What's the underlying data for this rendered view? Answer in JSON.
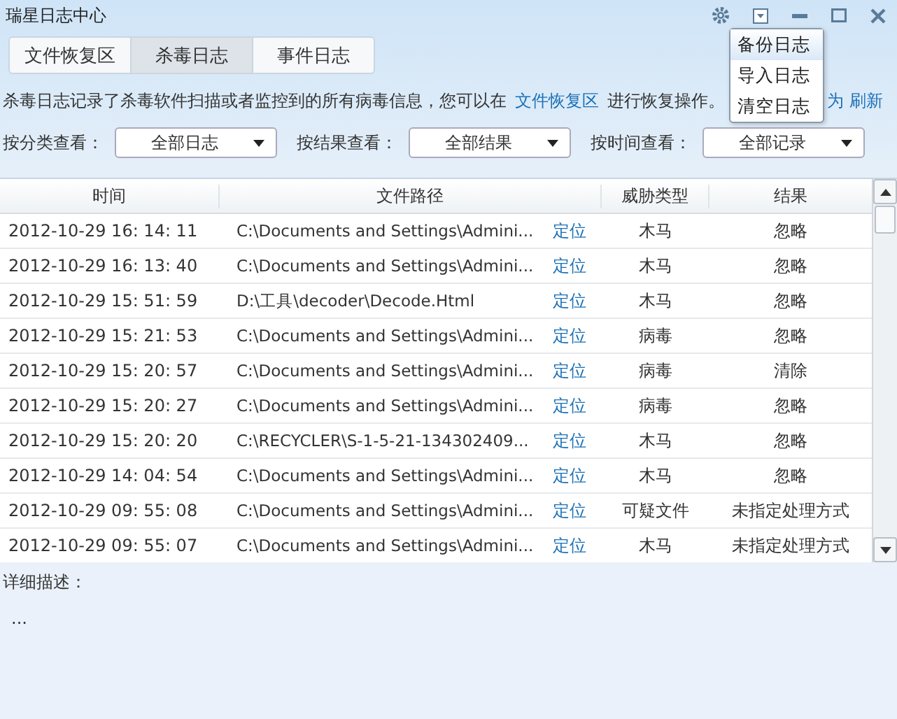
{
  "window": {
    "title": "瑞星日志中心"
  },
  "tabs": [
    {
      "label": "文件恢复区",
      "selected": false
    },
    {
      "label": "杀毒日志",
      "selected": true
    },
    {
      "label": "事件日志",
      "selected": false
    }
  ],
  "menu": {
    "items": [
      {
        "label": "备份日志",
        "selected": true
      },
      {
        "label": "导入日志",
        "selected": false
      },
      {
        "label": "清空日志",
        "selected": false
      }
    ]
  },
  "description": {
    "text": "杀毒日志记录了杀毒软件扫描或者监控到的所有病毒信息，您可以在",
    "link": "文件恢复区",
    "after": "进行恢复操作。",
    "partial": "为",
    "refresh": "刷新"
  },
  "filters": [
    {
      "label": "按分类查看：",
      "value": "全部日志"
    },
    {
      "label": "按结果查看：",
      "value": "全部结果"
    },
    {
      "label": "按时间查看：",
      "value": "全部记录"
    }
  ],
  "table": {
    "columns": [
      "时间",
      "文件路径",
      "威胁类型",
      "结果"
    ],
    "rows": [
      {
        "time": "2012-10-29 16: 14: 11",
        "path": "C:\\Documents  and  Settings\\Admini...",
        "locate": "定位",
        "threat": "木马",
        "result": "忽略"
      },
      {
        "time": "2012-10-29 16: 13: 40",
        "path": "C:\\Documents  and  Settings\\Admini...",
        "locate": "定位",
        "threat": "木马",
        "result": "忽略"
      },
      {
        "time": "2012-10-29 15: 51: 59",
        "path": "D:\\工具\\decoder\\Decode.Html",
        "locate": "定位",
        "threat": "木马",
        "result": "忽略"
      },
      {
        "time": "2012-10-29 15: 21: 53",
        "path": "C:\\Documents  and  Settings\\Admini...",
        "locate": "定位",
        "threat": "病毒",
        "result": "忽略"
      },
      {
        "time": "2012-10-29 15: 20: 57",
        "path": "C:\\Documents  and  Settings\\Admini...",
        "locate": "定位",
        "threat": "病毒",
        "result": "清除"
      },
      {
        "time": "2012-10-29 15: 20: 27",
        "path": "C:\\Documents  and  Settings\\Admini...",
        "locate": "定位",
        "threat": "病毒",
        "result": "忽略"
      },
      {
        "time": "2012-10-29 15: 20: 20",
        "path": "C:\\RECYCLER\\S-1-5-21-134302409...",
        "locate": "定位",
        "threat": "木马",
        "result": "忽略"
      },
      {
        "time": "2012-10-29 14: 04: 54",
        "path": "C:\\Documents  and  Settings\\Admini...",
        "locate": "定位",
        "threat": "木马",
        "result": "忽略"
      },
      {
        "time": "2012-10-29 09: 55: 08",
        "path": "C:\\Documents  and  Settings\\Admini...",
        "locate": "定位",
        "threat": "可疑文件",
        "result": "未指定处理方式"
      },
      {
        "time": "2012-10-29 09: 55: 07",
        "path": "C:\\Documents  and  Settings\\Admini...",
        "locate": "定位",
        "threat": "木马",
        "result": "未指定处理方式"
      }
    ]
  },
  "detail": {
    "label": "详细描述：",
    "text": "..."
  }
}
